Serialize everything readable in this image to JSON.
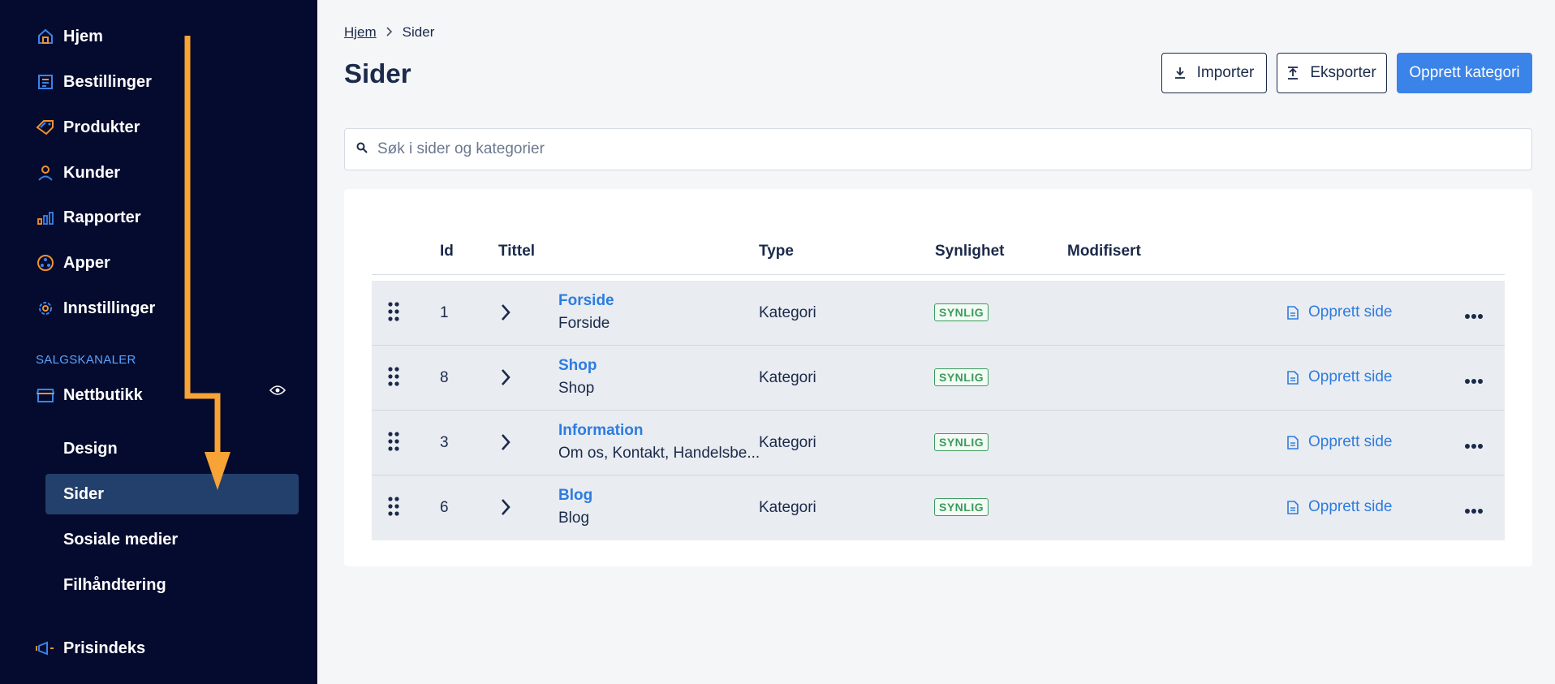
{
  "sidebar": {
    "items": [
      {
        "label": "Hjem",
        "icon": "home-icon"
      },
      {
        "label": "Bestillinger",
        "icon": "orders-icon"
      },
      {
        "label": "Produkter",
        "icon": "tag-icon"
      },
      {
        "label": "Kunder",
        "icon": "user-icon"
      },
      {
        "label": "Rapporter",
        "icon": "bar-chart-icon"
      },
      {
        "label": "Apper",
        "icon": "apps-icon"
      },
      {
        "label": "Innstillinger",
        "icon": "gear-icon"
      }
    ],
    "section_label": "SALGSKANALER",
    "channel": {
      "label": "Nettbutikk",
      "icon": "store-icon"
    },
    "sub_items": [
      "Design",
      "Sider",
      "Sosiale medier",
      "Filhåndtering"
    ],
    "active_sub_item": "Sider",
    "bottom_item": {
      "label": "Prisindeks",
      "icon": "megaphone-icon"
    }
  },
  "breadcrumb": {
    "home": "Hjem",
    "current": "Sider"
  },
  "page_title": "Sider",
  "actions": {
    "import_label": "Importer",
    "export_label": "Eksporter",
    "create_category_label": "Opprett kategori"
  },
  "search": {
    "placeholder": "Søk i sider og kategorier"
  },
  "table": {
    "headers": {
      "id": "Id",
      "title": "Tittel",
      "type": "Type",
      "visibility": "Synlighet",
      "modified": "Modifisert"
    },
    "rows": [
      {
        "id": "1",
        "title": "Forside",
        "subtitle": "Forside",
        "type": "Kategori",
        "visibility": "SYNLIG",
        "create_label": "Opprett side"
      },
      {
        "id": "8",
        "title": "Shop",
        "subtitle": "Shop",
        "type": "Kategori",
        "visibility": "SYNLIG",
        "create_label": "Opprett side"
      },
      {
        "id": "3",
        "title": "Information",
        "subtitle": "Om os, Kontakt, Handelsbe...",
        "type": "Kategori",
        "visibility": "SYNLIG",
        "create_label": "Opprett side"
      },
      {
        "id": "6",
        "title": "Blog",
        "subtitle": "Blog",
        "type": "Kategori",
        "visibility": "SYNLIG",
        "create_label": "Opprett side"
      }
    ]
  },
  "colors": {
    "sidebar_bg": "#050b2e",
    "accent": "#3a83e8",
    "icon_orange": "#f0922e",
    "badge_green": "#3c9b5c",
    "annotation_arrow": "#f7a335"
  }
}
